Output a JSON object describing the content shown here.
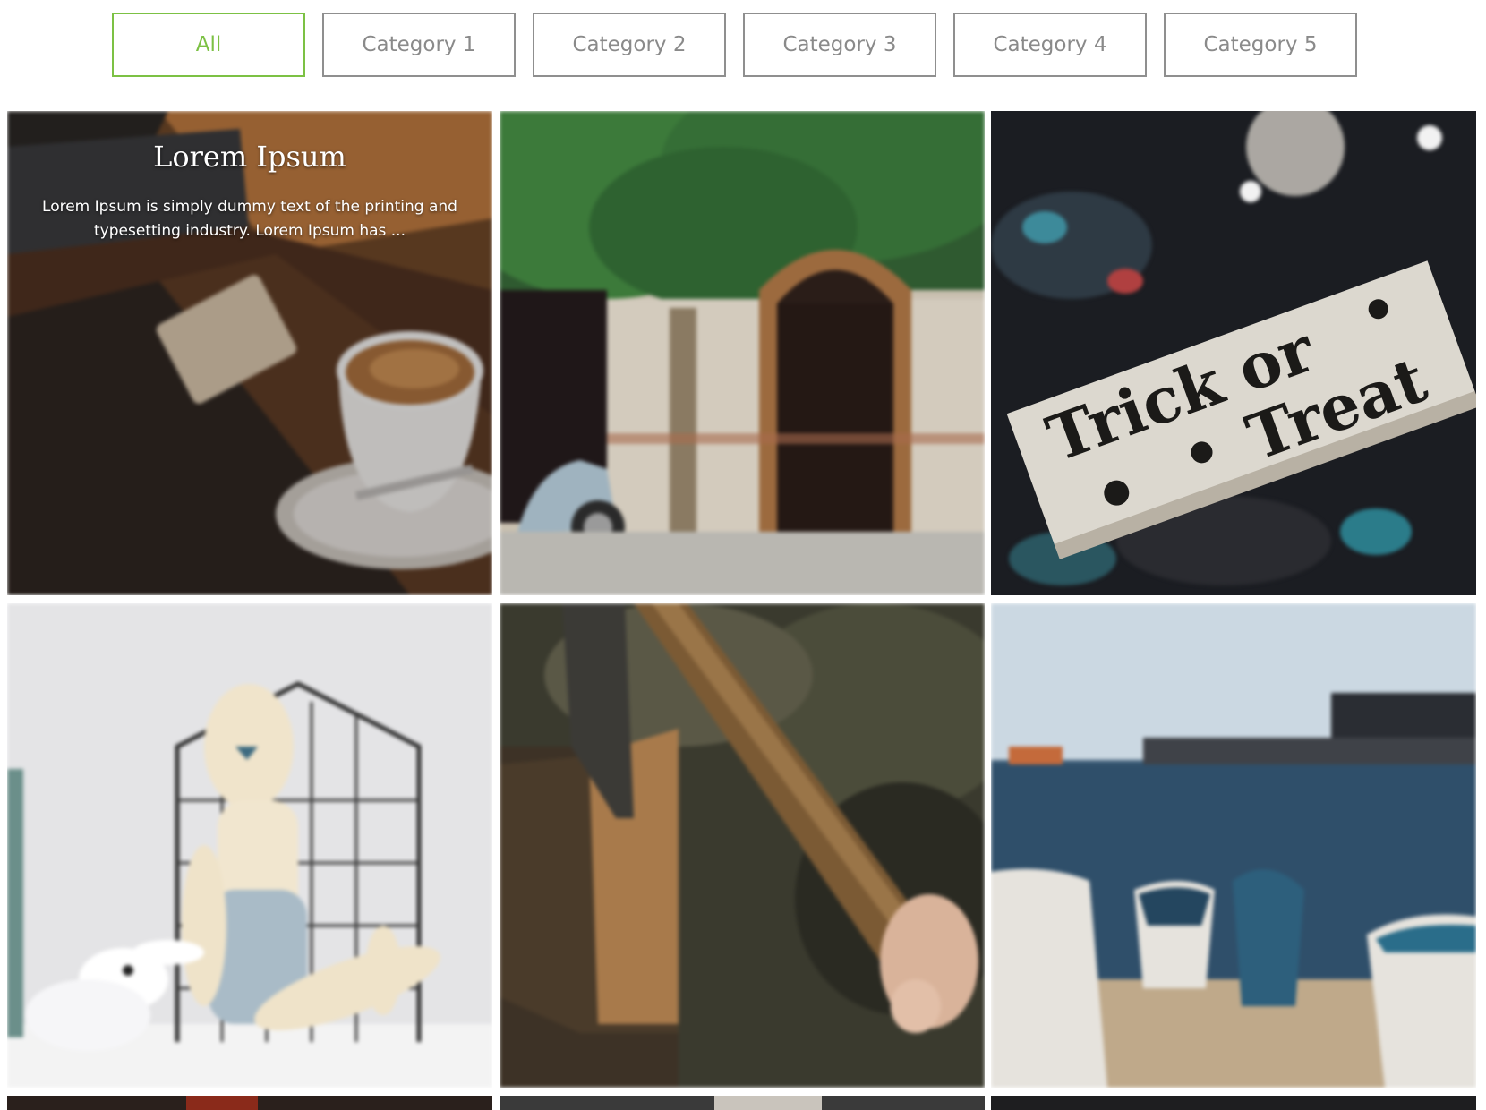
{
  "filters": [
    {
      "label": "All",
      "active": true
    },
    {
      "label": "Category 1",
      "active": false
    },
    {
      "label": "Category 2",
      "active": false
    },
    {
      "label": "Category 3",
      "active": false
    },
    {
      "label": "Category 4",
      "active": false
    },
    {
      "label": "Category 5",
      "active": false
    }
  ],
  "gallery": {
    "hover_item": {
      "title": "Lorem Ipsum",
      "excerpt": "Lorem Ipsum is simply dummy text of the printing and typesetting industry. Lorem Ipsum has ..."
    },
    "sign_text": {
      "line1": "Trick or",
      "line2": "Treat"
    }
  },
  "colors": {
    "accent": "#7cc144",
    "button_border": "#8f8f8f",
    "button_text": "#8a8a8a"
  }
}
